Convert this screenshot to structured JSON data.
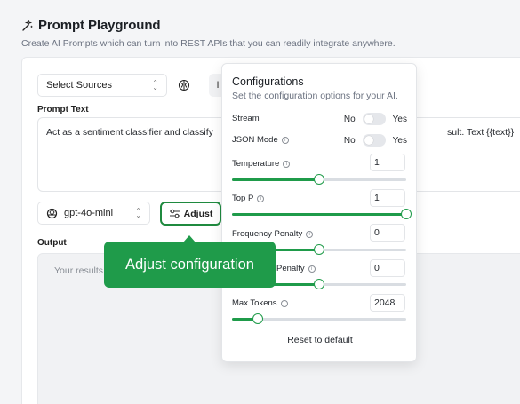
{
  "header": {
    "title": "Prompt Playground",
    "subtitle": "Create AI Prompts which can turn into REST APIs that you can readily integrate anywhere."
  },
  "toolbar": {
    "sources_select": "Select Sources",
    "partial_button_letter": "I"
  },
  "prompt": {
    "label": "Prompt Text",
    "text_start": "Act as a sentiment classifier and classify",
    "text_end": "sult. Text {{text}}"
  },
  "model": {
    "selected": "gpt-4o-mini",
    "adjust_label": "Adjust"
  },
  "output": {
    "label": "Output",
    "placeholder": "Your results"
  },
  "tooltip": {
    "text": "Adjust configuration"
  },
  "config": {
    "title": "Configurations",
    "subtitle": "Set the configuration options for your AI.",
    "stream": {
      "label": "Stream",
      "off": "No",
      "on": "Yes",
      "enabled": false
    },
    "json_mode": {
      "label": "JSON Mode",
      "off": "No",
      "on": "Yes",
      "enabled": false
    },
    "temperature": {
      "label": "Temperature",
      "value": "1",
      "fraction": 0.5
    },
    "top_p": {
      "label": "Top P",
      "value": "1",
      "fraction": 1.0
    },
    "frequency_penalty": {
      "label": "Frequency Penalty",
      "value": "0",
      "fraction": 0.5
    },
    "presence_penalty": {
      "label": "Penalty",
      "value": "0",
      "fraction": 0.5
    },
    "max_tokens": {
      "label": "Max Tokens",
      "value": "2048",
      "fraction": 0.15
    },
    "reset_label": "Reset to default"
  },
  "colors": {
    "accent": "#1f9b4a",
    "highlight_border": "#1f8a3f"
  }
}
